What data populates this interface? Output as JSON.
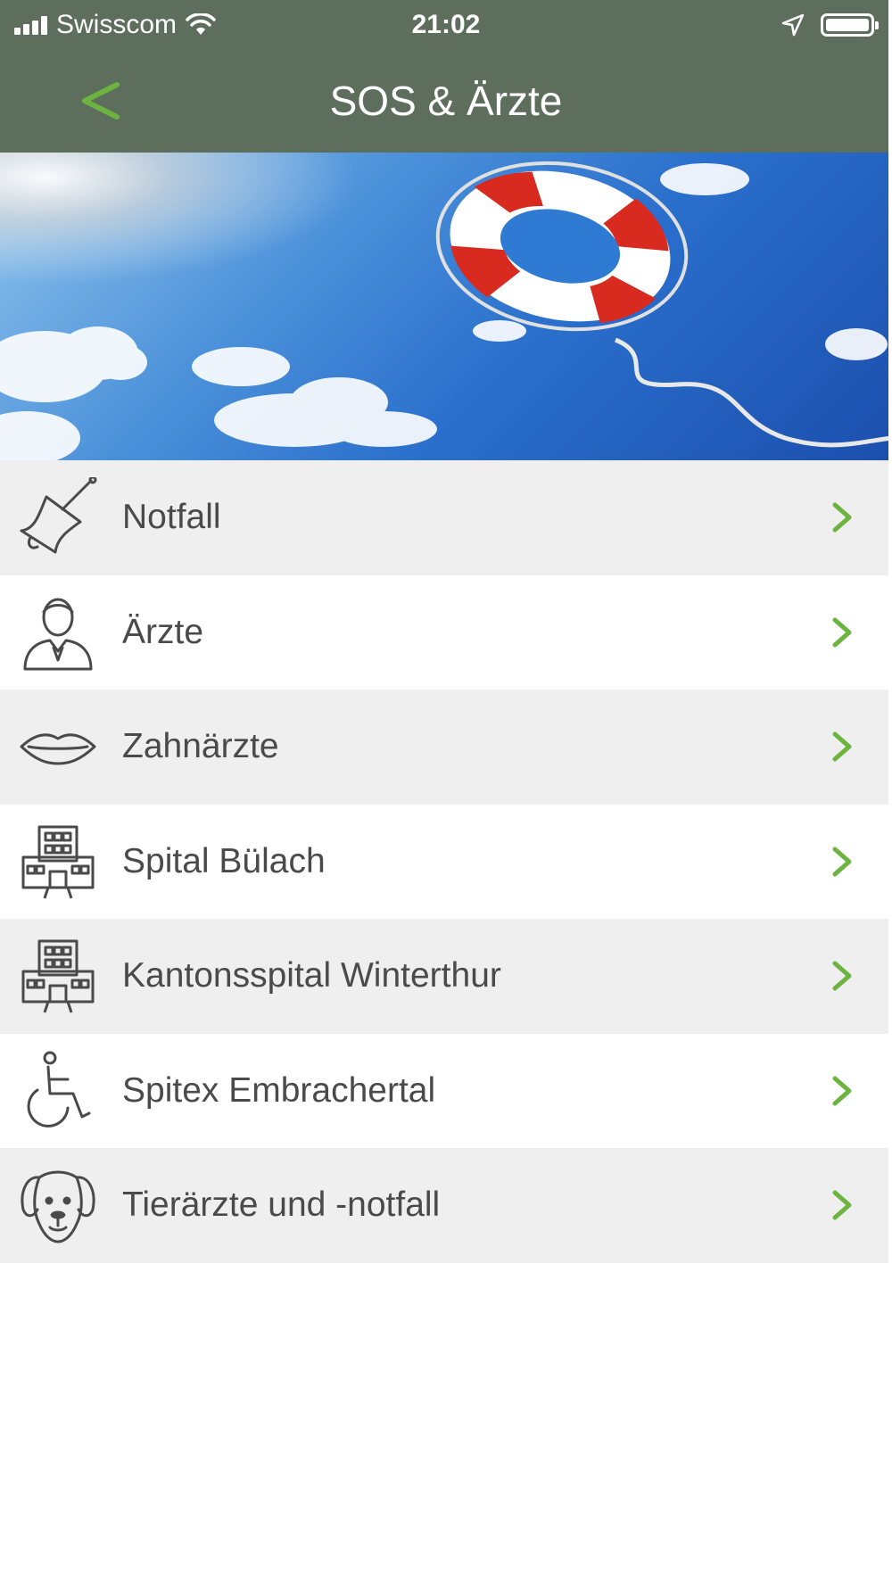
{
  "status_bar": {
    "carrier": "Swisscom",
    "time": "21:02"
  },
  "header": {
    "title": "SOS & Ärzte",
    "back_label": "<"
  },
  "hero": {
    "image": "lifebuoy-in-sky"
  },
  "menu": {
    "items": [
      {
        "label": "Notfall",
        "icon": "bell-icon"
      },
      {
        "label": "Ärzte",
        "icon": "doctor-icon"
      },
      {
        "label": "Zahnärzte",
        "icon": "lips-icon"
      },
      {
        "label": "Spital Bülach",
        "icon": "hospital-building-icon"
      },
      {
        "label": "Kantonsspital Winterthur",
        "icon": "hospital-building-icon"
      },
      {
        "label": "Spitex Embrachertal",
        "icon": "wheelchair-icon"
      },
      {
        "label": "Tierärzte und -notfall",
        "icon": "dog-icon"
      }
    ]
  },
  "colors": {
    "header_bg": "#5e6e5d",
    "accent_green": "#6db33f",
    "text": "#4a4a4a",
    "row_alt": "#efefef"
  }
}
